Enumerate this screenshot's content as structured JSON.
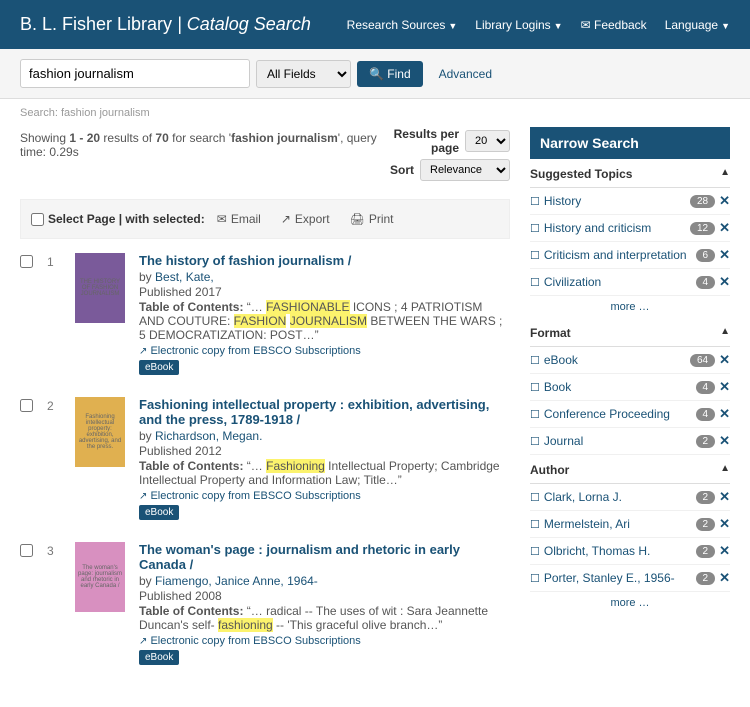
{
  "header": {
    "library": "B. L. Fisher Library",
    "page": "Catalog Search",
    "nav": [
      "Research Sources",
      "Library Logins",
      "Feedback",
      "Language"
    ]
  },
  "search": {
    "query": "fashion journalism",
    "field": "All Fields",
    "button": "Find",
    "advanced": "Advanced"
  },
  "breadcrumb": "Search: fashion journalism",
  "summary": {
    "range": "1 - 20",
    "total": "70",
    "term": "fashion journalism",
    "time": "0.29s"
  },
  "controls": {
    "rpp_label": "Results per page",
    "rpp": "20",
    "sort_label": "Sort",
    "sort": "Relevance"
  },
  "toolbar": {
    "select": "Select Page | with selected:",
    "email": "Email",
    "export": "Export",
    "print": "Print"
  },
  "results": [
    {
      "num": "1",
      "cover_bg": "#7a5a9a",
      "cover_text": "THE HISTORY OF FASHION JOURNALISM",
      "title": "The history of fashion journalism /",
      "author": "Best, Kate,",
      "pub": "Published 2017",
      "toc_pre": "“… ",
      "toc_hl1": "FASHIONABLE",
      "toc_mid1": " ICONS ; 4 PATRIOTISM AND COUTURE: ",
      "toc_hl2": "FASHION",
      "toc_mid2": " ",
      "toc_hl3": "JOURNALISM",
      "toc_mid3": " BETWEEN THE WARS ; 5 DEMOCRATIZATION: POST…”",
      "link": "Electronic copy from EBSCO Subscriptions",
      "format": "eBook"
    },
    {
      "num": "2",
      "cover_bg": "#e0b050",
      "cover_text": "Fashioning intellectual property: exhibition, advertising, and the press.",
      "title": "Fashioning intellectual property : exhibition, advertising, and the press, 1789-1918 /",
      "author": "Richardson, Megan.",
      "pub": "Published 2012",
      "toc_pre": "“… ",
      "toc_hl1": "Fashioning",
      "toc_mid1": " Intellectual Property; Cambridge Intellectual Property and Information Law; Title…”",
      "toc_hl2": "",
      "toc_mid2": "",
      "toc_hl3": "",
      "toc_mid3": "",
      "link": "Electronic copy from EBSCO Subscriptions",
      "format": "eBook"
    },
    {
      "num": "3",
      "cover_bg": "#d890c0",
      "cover_text": "The woman's page: journalism and rhetoric in early Canada /",
      "title": "The woman's page : journalism and rhetoric in early Canada /",
      "author": "Fiamengo, Janice Anne, 1964-",
      "pub": "Published 2008",
      "toc_pre": "“… radical -- The uses of wit : Sara Jeannette Duncan's self- ",
      "toc_hl1": "fashioning",
      "toc_mid1": " -- 'This graceful olive branch…”",
      "toc_hl2": "",
      "toc_mid2": "",
      "toc_hl3": "",
      "toc_mid3": "",
      "link": "Electronic copy from EBSCO Subscriptions",
      "format": "eBook"
    }
  ],
  "sidebar": {
    "title": "Narrow Search",
    "more": "more …",
    "groups": [
      {
        "title": "Suggested Topics",
        "items": [
          {
            "label": "History",
            "count": "28"
          },
          {
            "label": "History and criticism",
            "count": "12"
          },
          {
            "label": "Criticism and interpretation",
            "count": "6"
          },
          {
            "label": "Civilization",
            "count": "4"
          }
        ],
        "more": true
      },
      {
        "title": "Format",
        "items": [
          {
            "label": "eBook",
            "count": "64"
          },
          {
            "label": "Book",
            "count": "4"
          },
          {
            "label": "Conference Proceeding",
            "count": "4"
          },
          {
            "label": "Journal",
            "count": "2"
          }
        ],
        "more": false
      },
      {
        "title": "Author",
        "items": [
          {
            "label": "Clark, Lorna J.",
            "count": "2"
          },
          {
            "label": "Mermelstein, Ari",
            "count": "2"
          },
          {
            "label": "Olbricht, Thomas H.",
            "count": "2"
          },
          {
            "label": "Porter, Stanley E., 1956-",
            "count": "2"
          }
        ],
        "more": true
      }
    ]
  }
}
